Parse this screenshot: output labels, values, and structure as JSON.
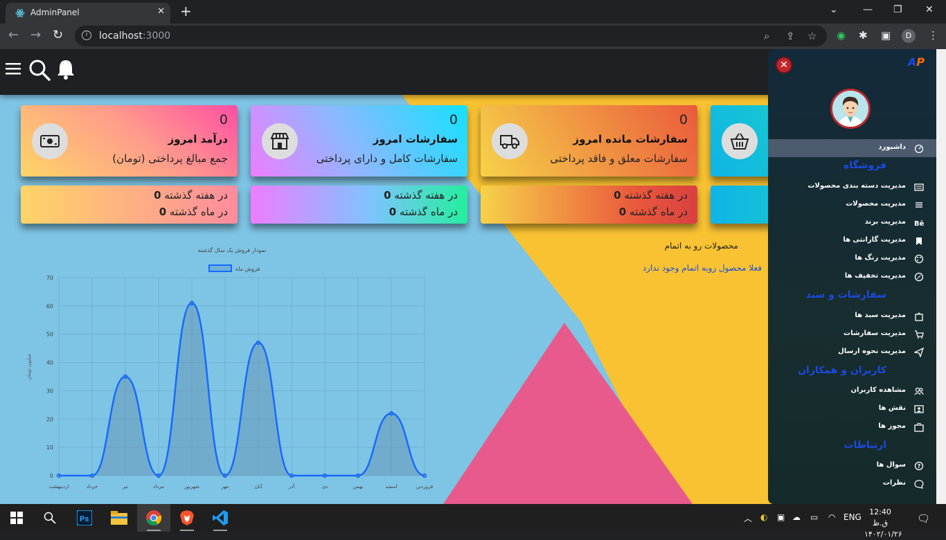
{
  "browser": {
    "tab_title": "AdminPanel",
    "new_tab_symbol": "+",
    "url_host": "localhost",
    "url_port": ":3000",
    "profile_initial": "D"
  },
  "cards": [
    {
      "value": "0",
      "title": "درآمد امروز",
      "subtitle": "جمع مبالغ پرداختی (تومان)",
      "icon": "money-icon"
    },
    {
      "value": "0",
      "title": "سفارشات امروز",
      "subtitle": "سفارشات کامل و دارای پرداختی",
      "icon": "store-icon"
    },
    {
      "value": "0",
      "title": "سفارشات مانده امروز",
      "subtitle": "سفارشات معلق و فاقد پرداختی",
      "icon": "truck-icon"
    },
    {
      "value": "",
      "title": "",
      "subtitle": "",
      "icon": "basket-icon"
    }
  ],
  "stats": [
    {
      "week_value": "0",
      "week_label": " در هفته گذشته",
      "month_value": "0",
      "month_label": " در ماه گذشته"
    },
    {
      "week_value": "0",
      "week_label": " در هفته گذشته",
      "month_value": "0",
      "month_label": " در ماه گذشته"
    },
    {
      "week_value": "0",
      "week_label": " در هفته گذشته",
      "month_value": "0",
      "month_label": " در ماه گذشته"
    }
  ],
  "chart_data": {
    "type": "area",
    "title": "نمودار فروش یک سال گذشته",
    "legend": "فروش ماه",
    "legend_position": "top",
    "ylabel": "میلیون تومان",
    "xlabel": "",
    "ylim": [
      0,
      70
    ],
    "yticks": [
      0,
      10,
      20,
      30,
      40,
      50,
      60,
      70
    ],
    "grid": true,
    "categories": [
      "اردیبهشت",
      "خرداد",
      "تیر",
      "مرداد",
      "شهریور",
      "مهر",
      "آبان",
      "آذر",
      "دی",
      "بهمن",
      "اسفند",
      "فروردین"
    ],
    "series": [
      {
        "name": "فروش ماه",
        "values": [
          0,
          0,
          35,
          0,
          61,
          0,
          47,
          0,
          0,
          0,
          22,
          0
        ]
      }
    ]
  },
  "top_products": {
    "title": "محصولات رو به اتمام",
    "empty_text": "فعلا محصول روبه اتمام وجود ندارد"
  },
  "sidebar": {
    "close_symbol": "✕",
    "logo_a": "A",
    "logo_p": "P",
    "items": [
      {
        "type": "item",
        "label": "داشبورد",
        "icon": "dashboard-icon",
        "active": true
      },
      {
        "type": "head",
        "label": "فروشگاه"
      },
      {
        "type": "item",
        "label": "مدیریت دسته بندی محصولات",
        "icon": "category-icon"
      },
      {
        "type": "item",
        "label": "مدیریت محصولات",
        "icon": "list-icon"
      },
      {
        "type": "item",
        "label": "مدیریت برند",
        "icon": "behance-icon"
      },
      {
        "type": "item",
        "label": "مدیریت گارانتی ها",
        "icon": "bookmark-icon"
      },
      {
        "type": "item",
        "label": "مدیریت رنگ ها",
        "icon": "palette-icon"
      },
      {
        "type": "item",
        "label": "مدیریت تخفیف ها",
        "icon": "discount-icon"
      },
      {
        "type": "head",
        "label": "سفارشات و سبد"
      },
      {
        "type": "item",
        "label": "مدیریت سبد ها",
        "icon": "bag-icon"
      },
      {
        "type": "item",
        "label": "مدیریت سفارشات",
        "icon": "cart-icon"
      },
      {
        "type": "item",
        "label": "مدیریت نحوه ارسال",
        "icon": "send-icon"
      },
      {
        "type": "head",
        "label": "کاربران و همکاران"
      },
      {
        "type": "item",
        "label": "مشاهده کاربران",
        "icon": "users-icon"
      },
      {
        "type": "item",
        "label": "نقش ها",
        "icon": "id-card-icon"
      },
      {
        "type": "item",
        "label": "مجوز ها",
        "icon": "briefcase-icon"
      },
      {
        "type": "head",
        "label": "ارتباطات"
      },
      {
        "type": "item",
        "label": "سوال ها",
        "icon": "question-icon"
      },
      {
        "type": "item",
        "label": "نظرات",
        "icon": "comment-icon"
      }
    ]
  },
  "taskbar": {
    "lang": "ENG",
    "time": "12:40 ق.ظ",
    "date": "۱۴۰۲/۰۱/۲۶"
  }
}
